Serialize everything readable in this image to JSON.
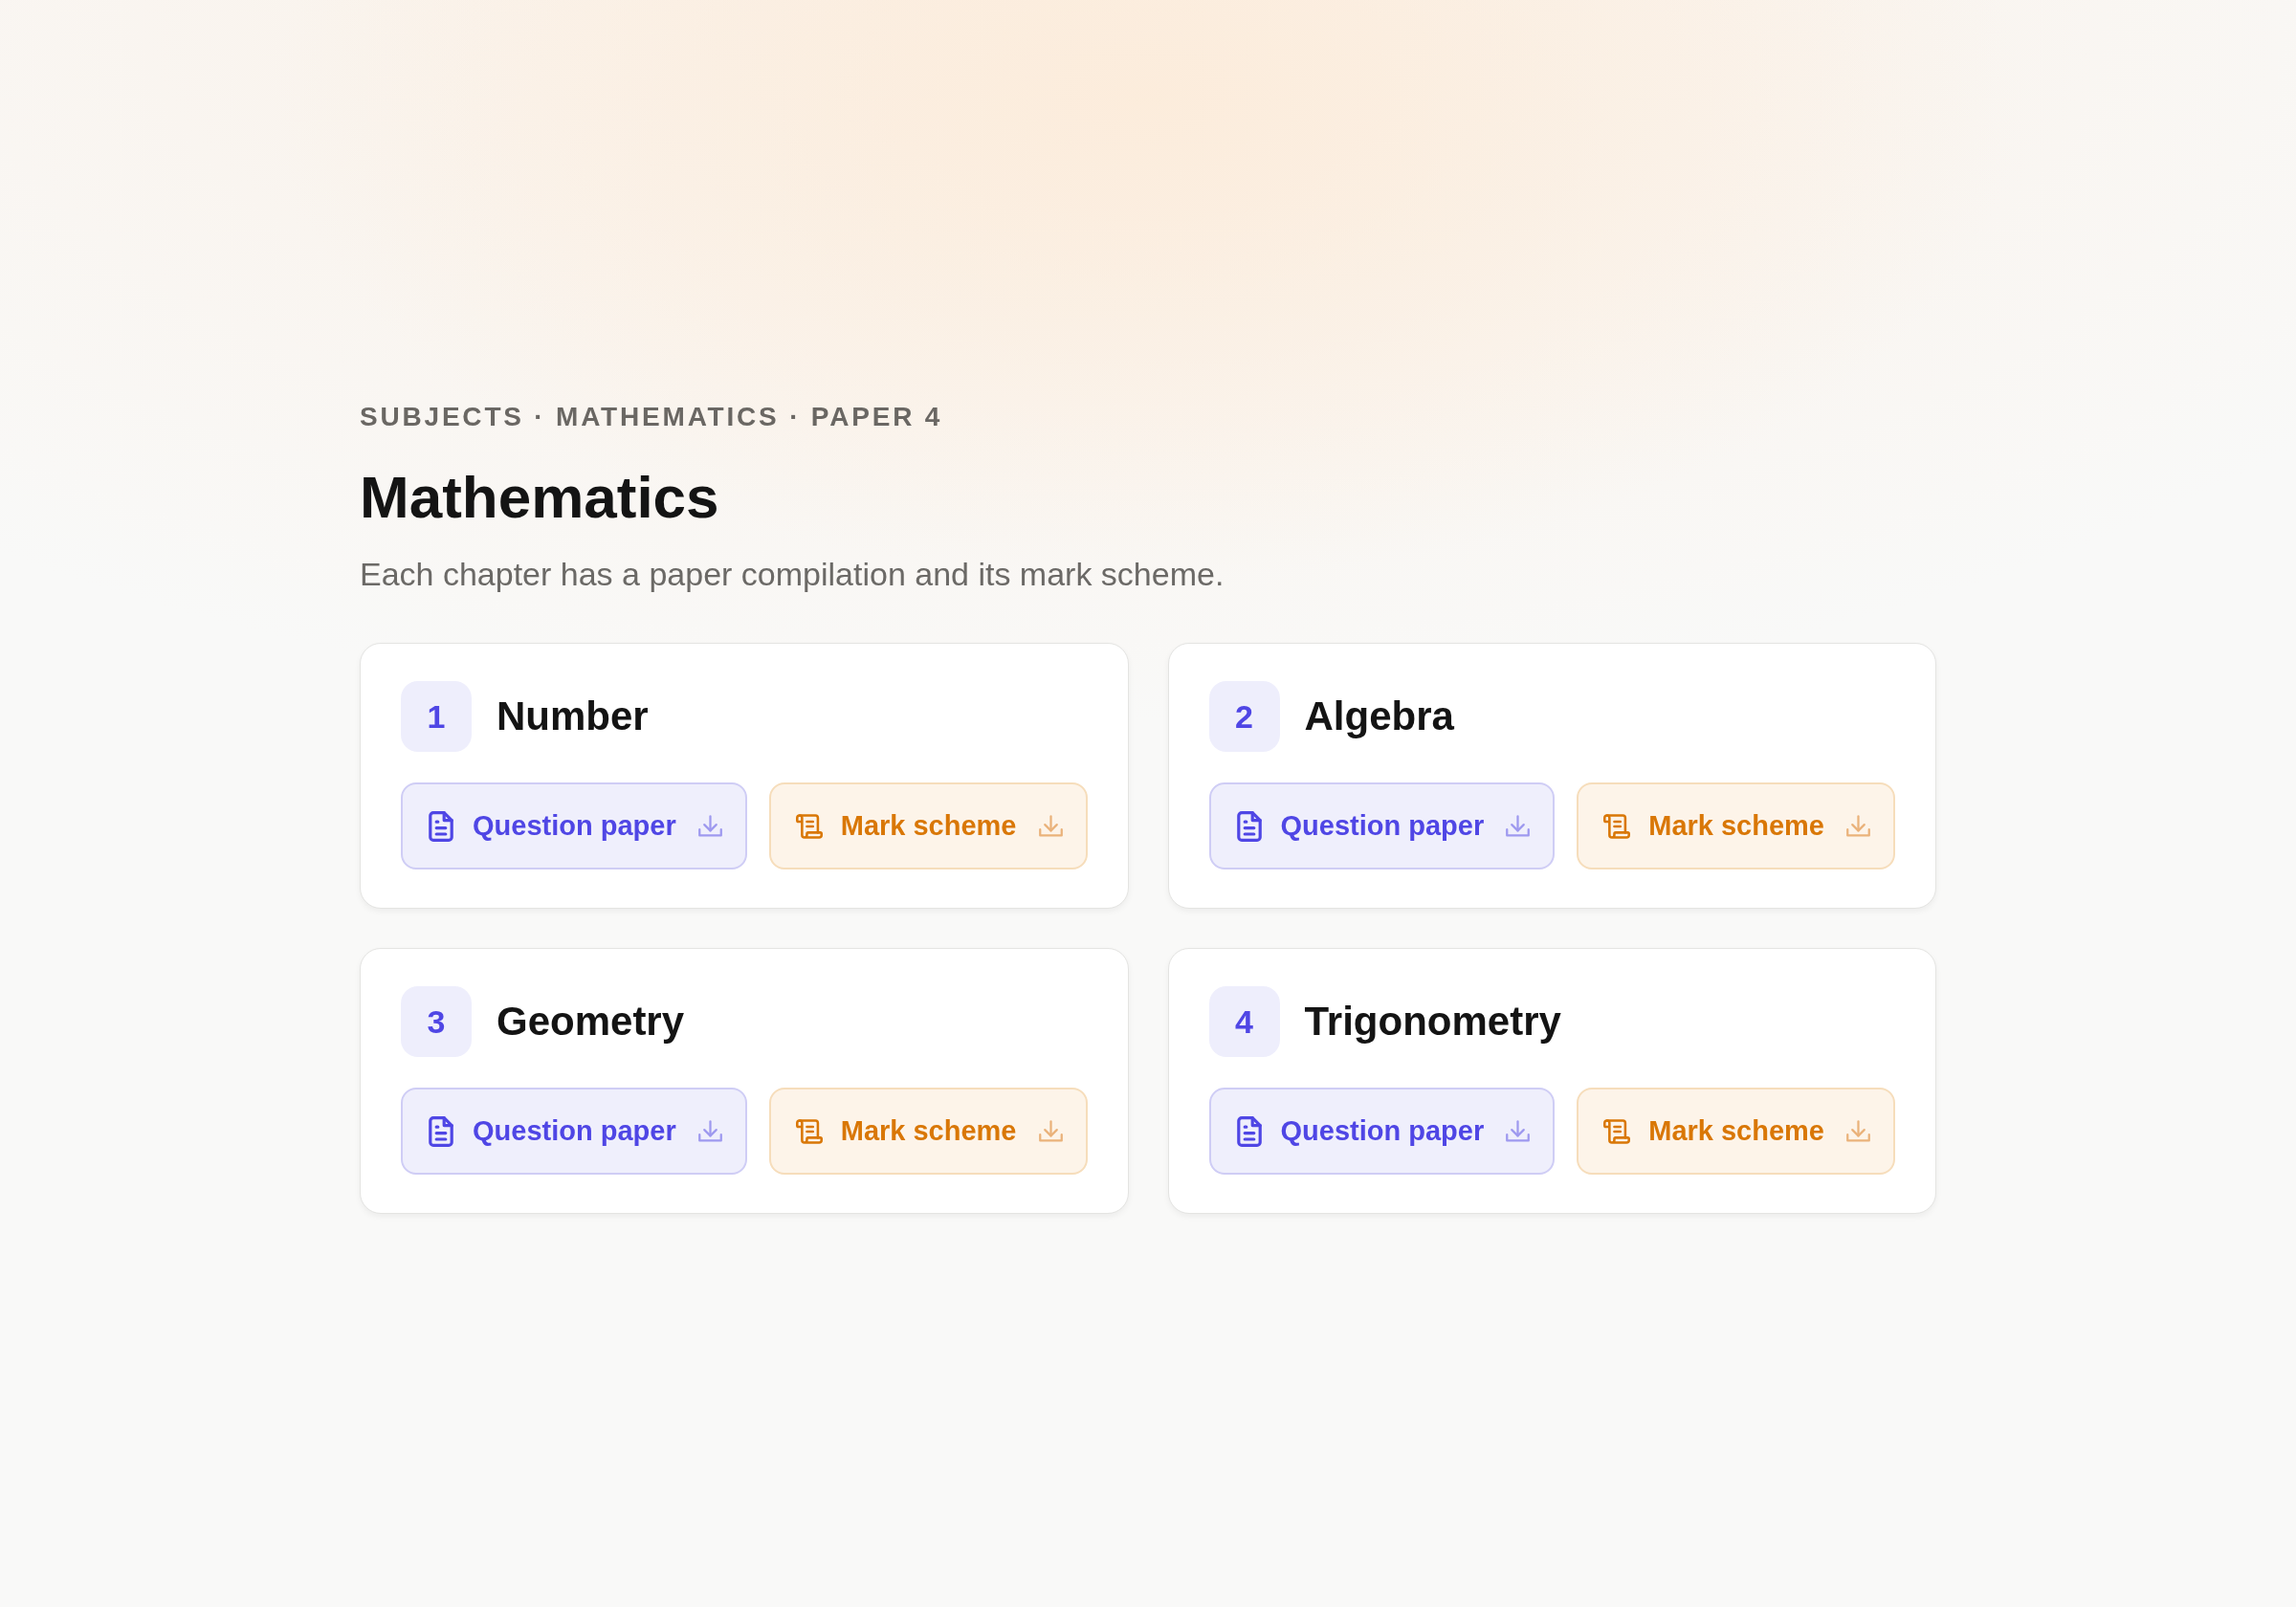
{
  "breadcrumb": "SUBJECTS · MATHEMATICS · PAPER 4",
  "title": "Mathematics",
  "subtitle": "Each chapter has a paper compilation and its mark scheme.",
  "chapters": [
    {
      "number": "1",
      "title": "Number",
      "buttons": [
        {
          "kind": "question",
          "label": "Question paper"
        },
        {
          "kind": "mark",
          "label": "Mark scheme"
        }
      ]
    },
    {
      "number": "2",
      "title": "Algebra",
      "buttons": [
        {
          "kind": "question",
          "label": "Question paper"
        },
        {
          "kind": "mark",
          "label": "Mark scheme"
        }
      ]
    },
    {
      "number": "3",
      "title": "Geometry",
      "buttons": [
        {
          "kind": "question",
          "label": "Question paper"
        },
        {
          "kind": "mark",
          "label": "Mark scheme"
        }
      ]
    },
    {
      "number": "4",
      "title": "Trigonometry",
      "buttons": [
        {
          "kind": "question",
          "label": "Question paper"
        },
        {
          "kind": "mark",
          "label": "Mark scheme"
        }
      ]
    }
  ]
}
